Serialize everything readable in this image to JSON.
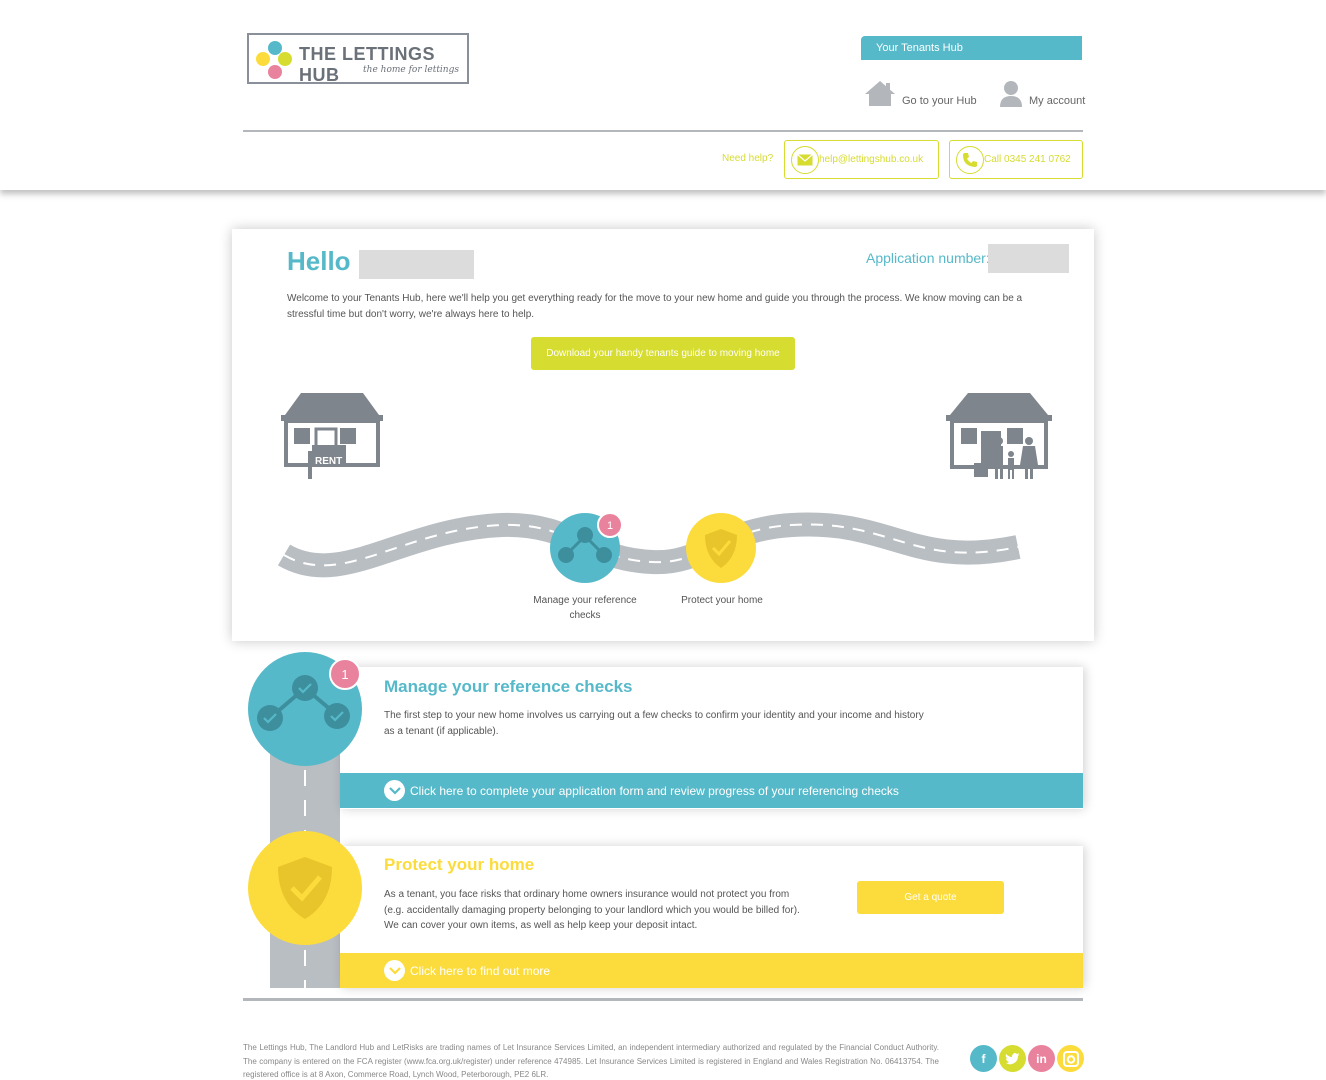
{
  "header": {
    "brand": "THE LETTINGS HUB",
    "tagline": "the home for lettings",
    "tab_label": "Your Tenants Hub",
    "nav": {
      "go_to_hub": "Go to your Hub",
      "my_account": "My account"
    },
    "need_help": "Need help?",
    "email": "help@lettingshub.co.uk",
    "phone": "Call 0345 241 0762"
  },
  "hello": {
    "greeting": "Hello",
    "application_label": "Application number:",
    "welcome_text": "Welcome to your Tenants Hub, here we'll help you get everything ready for the move to your new home and guide you through the process. We know moving can be a stressful time but don't worry, we're always here to help.",
    "guide_button": "Download your handy tenants guide to moving home",
    "rent_sign": "RENT",
    "stages": [
      {
        "label": "Manage your reference checks",
        "badge": "1"
      },
      {
        "label": "Protect your home"
      }
    ]
  },
  "steps": [
    {
      "title": "Manage your reference checks",
      "badge": "1",
      "description": "The first step to your new home involves us carrying out a few checks to confirm your identity and your income and history as a tenant (if applicable).",
      "action": "Click here to complete your application form and review progress of your referencing checks",
      "color": "#56b9c9"
    },
    {
      "title": "Protect your home",
      "description": "As a tenant, you face risks that ordinary home owners insurance would not protect you from (e.g. accidentally damaging property belonging to your landlord which you would be billed for). We can cover your own items, as well as help keep your deposit intact.",
      "quote_button": "Get a quote",
      "action": "Click here to find out more",
      "color": "#fcdc3c"
    }
  ],
  "footer": {
    "legal": "The Lettings Hub, The Landlord Hub and LetRisks are trading names of Let Insurance Services Limited, an independent intermediary authorized and regulated by the Financial Conduct Authority. The company is entered on the FCA register (www.fca.org.uk/register) under reference 474985. Let Insurance Services Limited is registered in England and Wales Registration No. 06413754. The registered office is at 8 Axon, Commerce Road, Lynch Wood, Peterborough, PE2 6LR.",
    "social": [
      "facebook-icon",
      "twitter-icon",
      "linkedin-icon",
      "instagram-icon"
    ]
  },
  "colors": {
    "teal": "#56b9c9",
    "lime": "#d6dc30",
    "yellow": "#fcdc3c",
    "pink": "#e9829d",
    "road": "#b9bec3"
  }
}
